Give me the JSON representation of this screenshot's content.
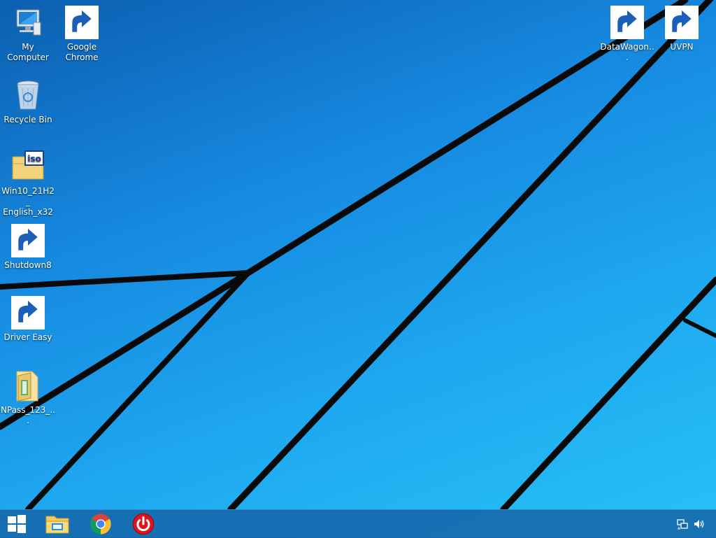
{
  "desktop": {
    "icons": [
      {
        "label": "My Computer",
        "icon": "computer-icon",
        "shortcut": false
      },
      {
        "label": "Google Chrome",
        "icon": "chrome-icon",
        "shortcut": true
      },
      {
        "label": "Recycle Bin",
        "icon": "recycle-bin-icon",
        "shortcut": false
      },
      {
        "label": "Win10_21H2_ English_x32",
        "icon": "iso-file-icon",
        "shortcut": false
      },
      {
        "label": "Shutdown8",
        "icon": "power-icon",
        "shortcut": true
      },
      {
        "label": "Driver Easy",
        "icon": "driver-easy-icon",
        "shortcut": true
      },
      {
        "label": "NPass_123_...",
        "icon": "folder-icon",
        "shortcut": false
      },
      {
        "label": "DataWagon...",
        "icon": "datawagon-icon",
        "shortcut": true
      },
      {
        "label": "UVPN",
        "icon": "uvpn-icon",
        "shortcut": true
      }
    ]
  },
  "taskbar": {
    "start_icon": "windows-start-icon",
    "pinned": [
      {
        "name": "file-explorer",
        "icon": "file-explorer-icon"
      },
      {
        "name": "google-chrome",
        "icon": "chrome-icon"
      },
      {
        "name": "shutdown8",
        "icon": "power-icon"
      }
    ],
    "tray": [
      {
        "name": "network",
        "icon": "network-icon"
      },
      {
        "name": "volume",
        "icon": "volume-icon"
      }
    ]
  },
  "colors": {
    "taskbar": "#1667aa",
    "wallpaper_light": "#27c2f7",
    "wallpaper_dark": "#0c5fb0",
    "power_red": "#e0141e"
  }
}
